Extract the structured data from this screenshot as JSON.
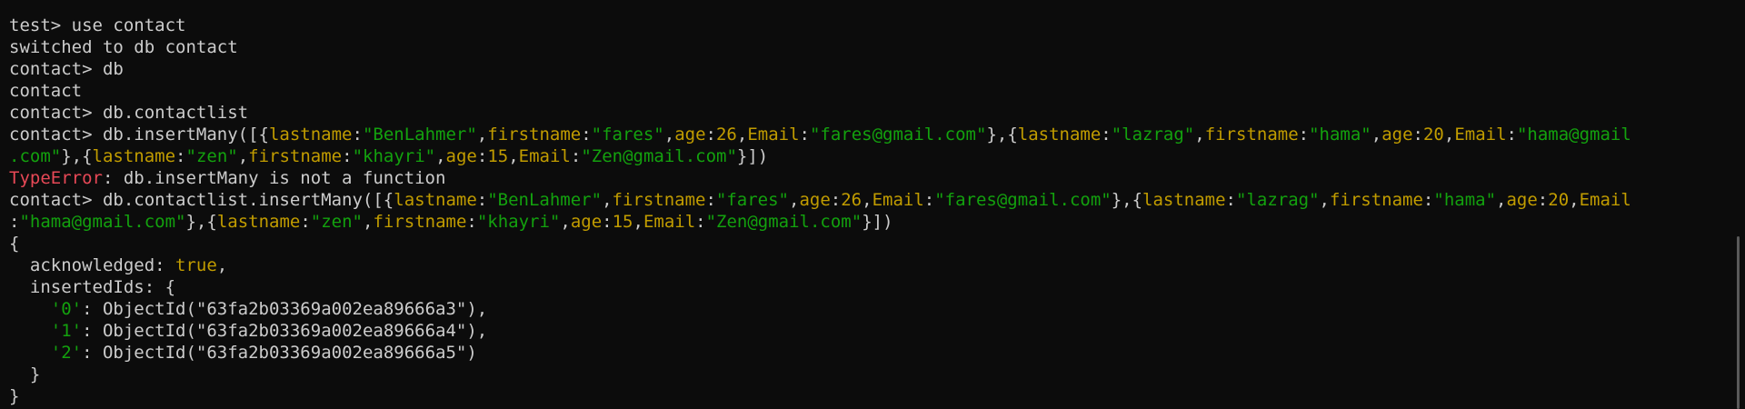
{
  "colors": {
    "background": "#0c0c0c",
    "text": "#cccccc",
    "key": "#c19c00",
    "string": "#13a10e",
    "error": "#e74856"
  },
  "lines": [
    [
      {
        "t": "test> use contact",
        "c": "plain"
      }
    ],
    [
      {
        "t": "switched to db contact",
        "c": "plain"
      }
    ],
    [
      {
        "t": "contact> db",
        "c": "plain"
      }
    ],
    [
      {
        "t": "contact",
        "c": "plain"
      }
    ],
    [
      {
        "t": "contact> db.contactlist",
        "c": "plain"
      }
    ],
    [
      {
        "t": "contact> db.insertMany([{",
        "c": "plain"
      },
      {
        "t": "lastname",
        "c": "key"
      },
      {
        "t": ":",
        "c": "plain"
      },
      {
        "t": "\"BenLahmer\"",
        "c": "str"
      },
      {
        "t": ",",
        "c": "plain"
      },
      {
        "t": "firstname",
        "c": "key"
      },
      {
        "t": ":",
        "c": "plain"
      },
      {
        "t": "\"fares\"",
        "c": "str"
      },
      {
        "t": ",",
        "c": "plain"
      },
      {
        "t": "age",
        "c": "key"
      },
      {
        "t": ":",
        "c": "plain"
      },
      {
        "t": "26",
        "c": "num"
      },
      {
        "t": ",",
        "c": "plain"
      },
      {
        "t": "Email",
        "c": "key"
      },
      {
        "t": ":",
        "c": "plain"
      },
      {
        "t": "\"fares@gmail.com\"",
        "c": "str"
      },
      {
        "t": "},{",
        "c": "plain"
      },
      {
        "t": "lastname",
        "c": "key"
      },
      {
        "t": ":",
        "c": "plain"
      },
      {
        "t": "\"lazrag\"",
        "c": "str"
      },
      {
        "t": ",",
        "c": "plain"
      },
      {
        "t": "firstname",
        "c": "key"
      },
      {
        "t": ":",
        "c": "plain"
      },
      {
        "t": "\"hama\"",
        "c": "str"
      },
      {
        "t": ",",
        "c": "plain"
      },
      {
        "t": "age",
        "c": "key"
      },
      {
        "t": ":",
        "c": "plain"
      },
      {
        "t": "20",
        "c": "num"
      },
      {
        "t": ",",
        "c": "plain"
      },
      {
        "t": "Email",
        "c": "key"
      },
      {
        "t": ":",
        "c": "plain"
      },
      {
        "t": "\"hama@gmail",
        "c": "str"
      }
    ],
    [
      {
        "t": ".com\"",
        "c": "str"
      },
      {
        "t": "},{",
        "c": "plain"
      },
      {
        "t": "lastname",
        "c": "key"
      },
      {
        "t": ":",
        "c": "plain"
      },
      {
        "t": "\"zen\"",
        "c": "str"
      },
      {
        "t": ",",
        "c": "plain"
      },
      {
        "t": "firstname",
        "c": "key"
      },
      {
        "t": ":",
        "c": "plain"
      },
      {
        "t": "\"khayri\"",
        "c": "str"
      },
      {
        "t": ",",
        "c": "plain"
      },
      {
        "t": "age",
        "c": "key"
      },
      {
        "t": ":",
        "c": "plain"
      },
      {
        "t": "15",
        "c": "num"
      },
      {
        "t": ",",
        "c": "plain"
      },
      {
        "t": "Email",
        "c": "key"
      },
      {
        "t": ":",
        "c": "plain"
      },
      {
        "t": "\"Zen@gmail.com\"",
        "c": "str"
      },
      {
        "t": "}])",
        "c": "plain"
      }
    ],
    [
      {
        "t": "TypeError",
        "c": "err"
      },
      {
        "t": ": db.insertMany is not a function",
        "c": "plain"
      }
    ],
    [
      {
        "t": "contact> db.contactlist.insertMany([{",
        "c": "plain"
      },
      {
        "t": "lastname",
        "c": "key"
      },
      {
        "t": ":",
        "c": "plain"
      },
      {
        "t": "\"BenLahmer\"",
        "c": "str"
      },
      {
        "t": ",",
        "c": "plain"
      },
      {
        "t": "firstname",
        "c": "key"
      },
      {
        "t": ":",
        "c": "plain"
      },
      {
        "t": "\"fares\"",
        "c": "str"
      },
      {
        "t": ",",
        "c": "plain"
      },
      {
        "t": "age",
        "c": "key"
      },
      {
        "t": ":",
        "c": "plain"
      },
      {
        "t": "26",
        "c": "num"
      },
      {
        "t": ",",
        "c": "plain"
      },
      {
        "t": "Email",
        "c": "key"
      },
      {
        "t": ":",
        "c": "plain"
      },
      {
        "t": "\"fares@gmail.com\"",
        "c": "str"
      },
      {
        "t": "},{",
        "c": "plain"
      },
      {
        "t": "lastname",
        "c": "key"
      },
      {
        "t": ":",
        "c": "plain"
      },
      {
        "t": "\"lazrag\"",
        "c": "str"
      },
      {
        "t": ",",
        "c": "plain"
      },
      {
        "t": "firstname",
        "c": "key"
      },
      {
        "t": ":",
        "c": "plain"
      },
      {
        "t": "\"hama\"",
        "c": "str"
      },
      {
        "t": ",",
        "c": "plain"
      },
      {
        "t": "age",
        "c": "key"
      },
      {
        "t": ":",
        "c": "plain"
      },
      {
        "t": "20",
        "c": "num"
      },
      {
        "t": ",",
        "c": "plain"
      },
      {
        "t": "Email",
        "c": "key"
      }
    ],
    [
      {
        "t": ":",
        "c": "plain"
      },
      {
        "t": "\"hama@gmail.com\"",
        "c": "str"
      },
      {
        "t": "},{",
        "c": "plain"
      },
      {
        "t": "lastname",
        "c": "key"
      },
      {
        "t": ":",
        "c": "plain"
      },
      {
        "t": "\"zen\"",
        "c": "str"
      },
      {
        "t": ",",
        "c": "plain"
      },
      {
        "t": "firstname",
        "c": "key"
      },
      {
        "t": ":",
        "c": "plain"
      },
      {
        "t": "\"khayri\"",
        "c": "str"
      },
      {
        "t": ",",
        "c": "plain"
      },
      {
        "t": "age",
        "c": "key"
      },
      {
        "t": ":",
        "c": "plain"
      },
      {
        "t": "15",
        "c": "num"
      },
      {
        "t": ",",
        "c": "plain"
      },
      {
        "t": "Email",
        "c": "key"
      },
      {
        "t": ":",
        "c": "plain"
      },
      {
        "t": "\"Zen@gmail.com\"",
        "c": "str"
      },
      {
        "t": "}])",
        "c": "plain"
      }
    ],
    [
      {
        "t": "{",
        "c": "plain"
      }
    ],
    [
      {
        "t": "  acknowledged: ",
        "c": "plain"
      },
      {
        "t": "true",
        "c": "bool"
      },
      {
        "t": ",",
        "c": "plain"
      }
    ],
    [
      {
        "t": "  insertedIds: {",
        "c": "plain"
      }
    ],
    [
      {
        "t": "    ",
        "c": "plain"
      },
      {
        "t": "'0'",
        "c": "str"
      },
      {
        "t": ": ObjectId(\"63fa2b03369a002ea89666a3\"),",
        "c": "plain"
      }
    ],
    [
      {
        "t": "    ",
        "c": "plain"
      },
      {
        "t": "'1'",
        "c": "str"
      },
      {
        "t": ": ObjectId(\"63fa2b03369a002ea89666a4\"),",
        "c": "plain"
      }
    ],
    [
      {
        "t": "    ",
        "c": "plain"
      },
      {
        "t": "'2'",
        "c": "str"
      },
      {
        "t": ": ObjectId(\"63fa2b03369a002ea89666a5\")",
        "c": "plain"
      }
    ],
    [
      {
        "t": "  }",
        "c": "plain"
      }
    ],
    [
      {
        "t": "}",
        "c": "plain"
      }
    ]
  ]
}
